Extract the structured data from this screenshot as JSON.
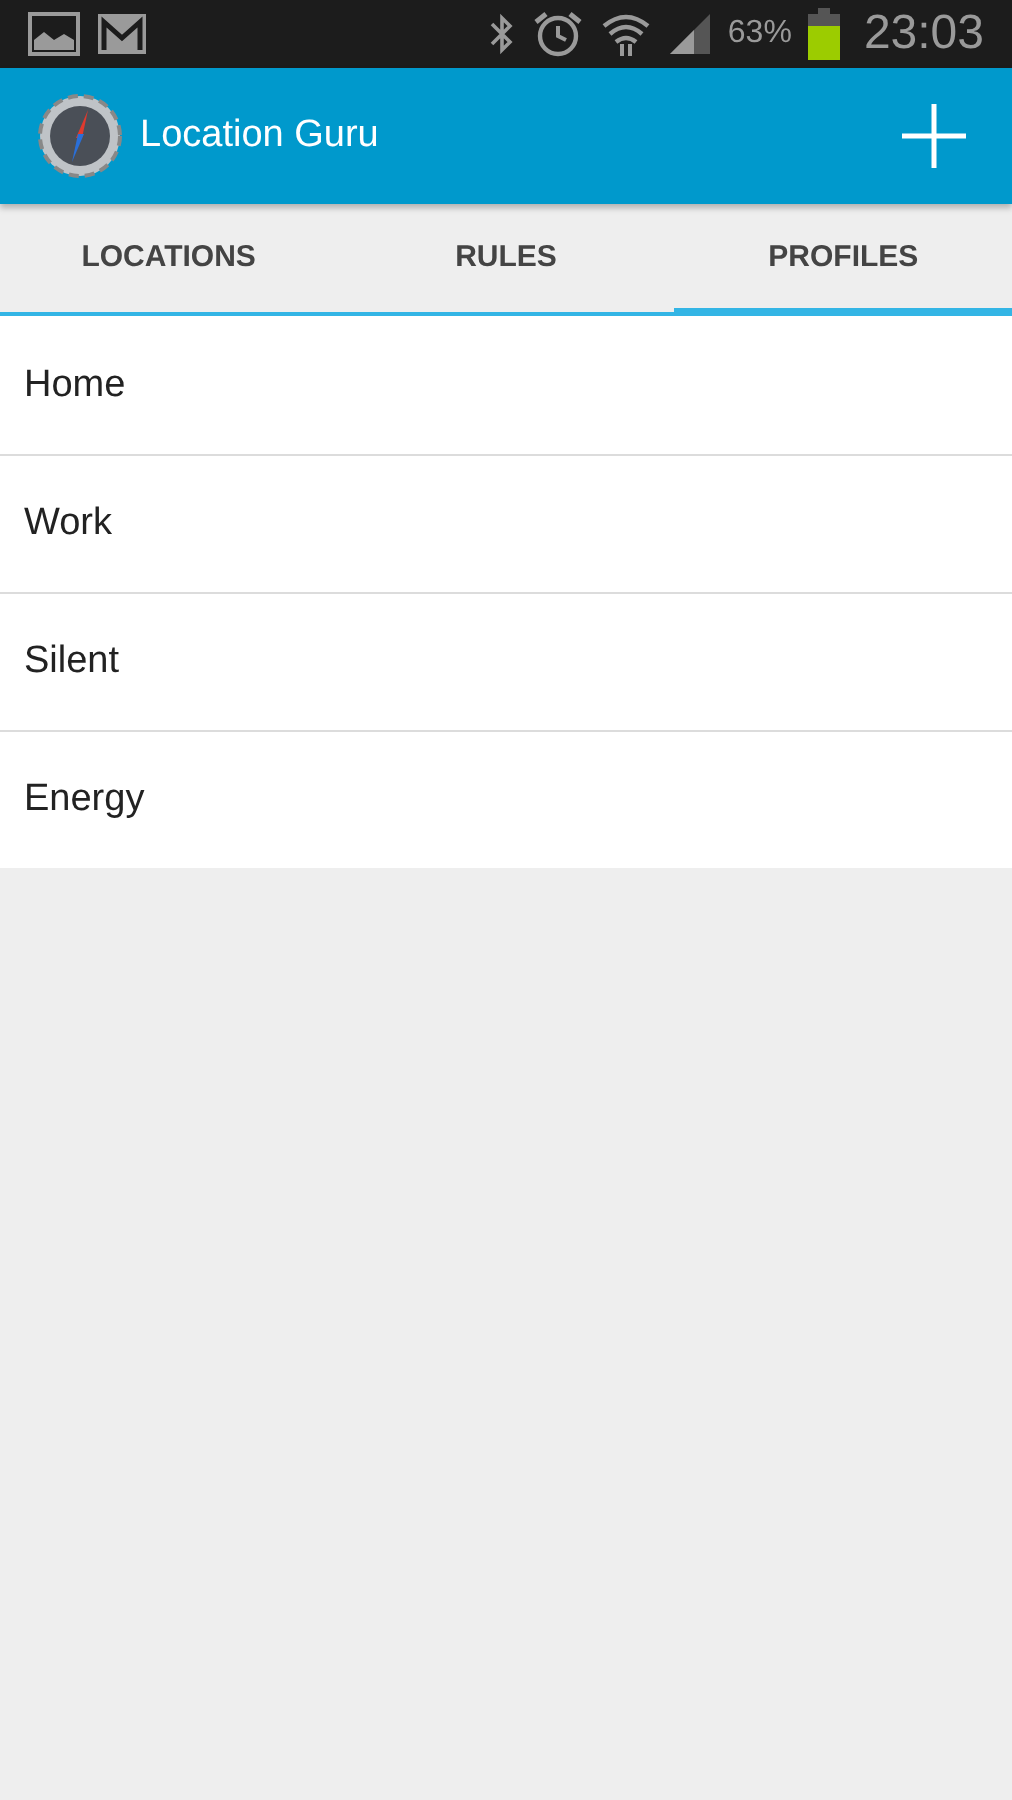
{
  "status_bar": {
    "battery_text": "63%",
    "time": "23:03"
  },
  "app_bar": {
    "title": "Location Guru"
  },
  "tabs": [
    {
      "label": "LOCATIONS",
      "selected": false
    },
    {
      "label": "RULES",
      "selected": false
    },
    {
      "label": "PROFILES",
      "selected": true
    }
  ],
  "profiles": [
    {
      "name": "Home"
    },
    {
      "name": "Work"
    },
    {
      "name": "Silent"
    },
    {
      "name": "Energy"
    }
  ]
}
